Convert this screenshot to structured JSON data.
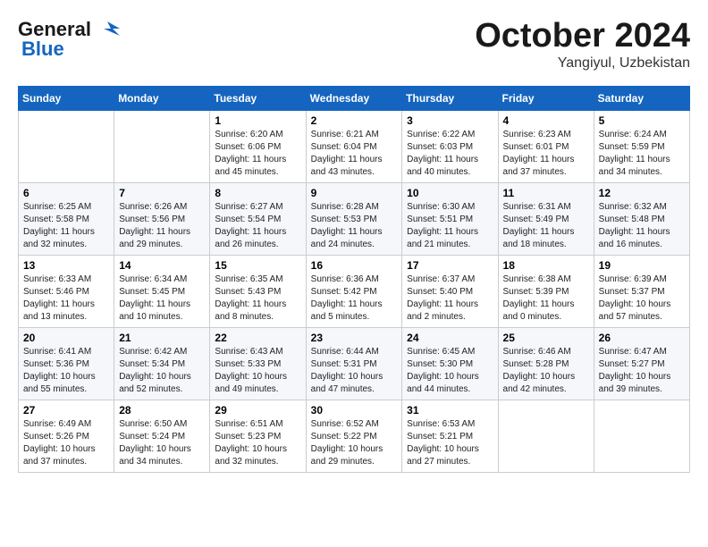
{
  "logo": {
    "general": "General",
    "blue": "Blue",
    "tagline": ""
  },
  "title": "October 2024",
  "location": "Yangiyul, Uzbekistan",
  "weekdays": [
    "Sunday",
    "Monday",
    "Tuesday",
    "Wednesday",
    "Thursday",
    "Friday",
    "Saturday"
  ],
  "weeks": [
    [
      null,
      null,
      {
        "day": 1,
        "sunrise": "6:20 AM",
        "sunset": "6:06 PM",
        "daylight": "11 hours and 45 minutes."
      },
      {
        "day": 2,
        "sunrise": "6:21 AM",
        "sunset": "6:04 PM",
        "daylight": "11 hours and 43 minutes."
      },
      {
        "day": 3,
        "sunrise": "6:22 AM",
        "sunset": "6:03 PM",
        "daylight": "11 hours and 40 minutes."
      },
      {
        "day": 4,
        "sunrise": "6:23 AM",
        "sunset": "6:01 PM",
        "daylight": "11 hours and 37 minutes."
      },
      {
        "day": 5,
        "sunrise": "6:24 AM",
        "sunset": "5:59 PM",
        "daylight": "11 hours and 34 minutes."
      }
    ],
    [
      {
        "day": 6,
        "sunrise": "6:25 AM",
        "sunset": "5:58 PM",
        "daylight": "11 hours and 32 minutes."
      },
      {
        "day": 7,
        "sunrise": "6:26 AM",
        "sunset": "5:56 PM",
        "daylight": "11 hours and 29 minutes."
      },
      {
        "day": 8,
        "sunrise": "6:27 AM",
        "sunset": "5:54 PM",
        "daylight": "11 hours and 26 minutes."
      },
      {
        "day": 9,
        "sunrise": "6:28 AM",
        "sunset": "5:53 PM",
        "daylight": "11 hours and 24 minutes."
      },
      {
        "day": 10,
        "sunrise": "6:30 AM",
        "sunset": "5:51 PM",
        "daylight": "11 hours and 21 minutes."
      },
      {
        "day": 11,
        "sunrise": "6:31 AM",
        "sunset": "5:49 PM",
        "daylight": "11 hours and 18 minutes."
      },
      {
        "day": 12,
        "sunrise": "6:32 AM",
        "sunset": "5:48 PM",
        "daylight": "11 hours and 16 minutes."
      }
    ],
    [
      {
        "day": 13,
        "sunrise": "6:33 AM",
        "sunset": "5:46 PM",
        "daylight": "11 hours and 13 minutes."
      },
      {
        "day": 14,
        "sunrise": "6:34 AM",
        "sunset": "5:45 PM",
        "daylight": "11 hours and 10 minutes."
      },
      {
        "day": 15,
        "sunrise": "6:35 AM",
        "sunset": "5:43 PM",
        "daylight": "11 hours and 8 minutes."
      },
      {
        "day": 16,
        "sunrise": "6:36 AM",
        "sunset": "5:42 PM",
        "daylight": "11 hours and 5 minutes."
      },
      {
        "day": 17,
        "sunrise": "6:37 AM",
        "sunset": "5:40 PM",
        "daylight": "11 hours and 2 minutes."
      },
      {
        "day": 18,
        "sunrise": "6:38 AM",
        "sunset": "5:39 PM",
        "daylight": "11 hours and 0 minutes."
      },
      {
        "day": 19,
        "sunrise": "6:39 AM",
        "sunset": "5:37 PM",
        "daylight": "10 hours and 57 minutes."
      }
    ],
    [
      {
        "day": 20,
        "sunrise": "6:41 AM",
        "sunset": "5:36 PM",
        "daylight": "10 hours and 55 minutes."
      },
      {
        "day": 21,
        "sunrise": "6:42 AM",
        "sunset": "5:34 PM",
        "daylight": "10 hours and 52 minutes."
      },
      {
        "day": 22,
        "sunrise": "6:43 AM",
        "sunset": "5:33 PM",
        "daylight": "10 hours and 49 minutes."
      },
      {
        "day": 23,
        "sunrise": "6:44 AM",
        "sunset": "5:31 PM",
        "daylight": "10 hours and 47 minutes."
      },
      {
        "day": 24,
        "sunrise": "6:45 AM",
        "sunset": "5:30 PM",
        "daylight": "10 hours and 44 minutes."
      },
      {
        "day": 25,
        "sunrise": "6:46 AM",
        "sunset": "5:28 PM",
        "daylight": "10 hours and 42 minutes."
      },
      {
        "day": 26,
        "sunrise": "6:47 AM",
        "sunset": "5:27 PM",
        "daylight": "10 hours and 39 minutes."
      }
    ],
    [
      {
        "day": 27,
        "sunrise": "6:49 AM",
        "sunset": "5:26 PM",
        "daylight": "10 hours and 37 minutes."
      },
      {
        "day": 28,
        "sunrise": "6:50 AM",
        "sunset": "5:24 PM",
        "daylight": "10 hours and 34 minutes."
      },
      {
        "day": 29,
        "sunrise": "6:51 AM",
        "sunset": "5:23 PM",
        "daylight": "10 hours and 32 minutes."
      },
      {
        "day": 30,
        "sunrise": "6:52 AM",
        "sunset": "5:22 PM",
        "daylight": "10 hours and 29 minutes."
      },
      {
        "day": 31,
        "sunrise": "6:53 AM",
        "sunset": "5:21 PM",
        "daylight": "10 hours and 27 minutes."
      },
      null,
      null
    ]
  ],
  "labels": {
    "sunrise": "Sunrise:",
    "sunset": "Sunset:",
    "daylight": "Daylight:"
  }
}
